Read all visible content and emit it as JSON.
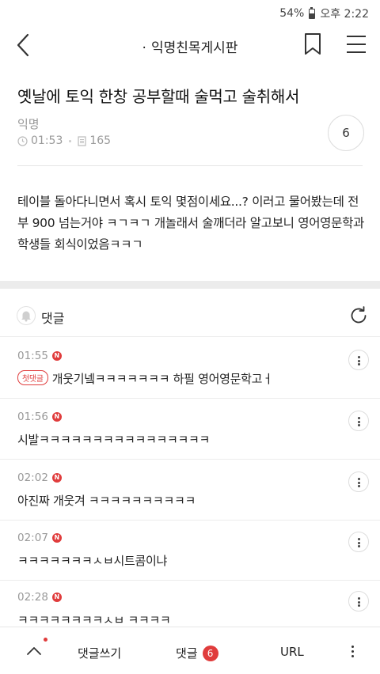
{
  "status_bar": {
    "battery": "54%",
    "time": "오후 2:22"
  },
  "header": {
    "title": "익명친목게시판",
    "title_prefix": "·"
  },
  "post": {
    "title": "옛날에 토익 한창 공부할때 술먹고 술취해서",
    "author": "익명",
    "time": "01:53",
    "views": "165",
    "comment_count": "6",
    "body": "테이블 돌아다니면서 혹시 토익 몇점이세요...? 이러고 물어봤는데 전부 900 넘는거야 ㅋㄱㅋㄱ 개놀래서 술깨더라 알고보니 영어영문학과 학생들 회식이었음ㅋㅋㄱ"
  },
  "comments_section": {
    "label": "댓글",
    "new_badge": "N",
    "first_comment_badge": "첫댓글",
    "items": [
      {
        "time": "01:55",
        "text": "개웃기넼ㅋㅋㅋㅋㅋㅋㅋ 하필 영어영문학고ㅓ"
      },
      {
        "time": "01:56",
        "text": "시발ㅋㅋㅋㅋㅋㅋㅋㅋㅋㅋㅋㅋㅋㅋㅋㅋ"
      },
      {
        "time": "02:02",
        "text": "아진짜 개웃겨 ㅋㅋㅋㅋㅋㅋㅋㅋㅋㅋ"
      },
      {
        "time": "02:07",
        "text": "ㅋㅋㅋㅋㅋㅋㅋㅅㅂ시트콤이냐"
      },
      {
        "time": "02:28",
        "text": "ㅋㅋㅋㅋㅋㅋㅋㅋㅅㅂ ㅋㅋㅋㅋ"
      }
    ]
  },
  "bottom_bar": {
    "write_label": "댓글쓰기",
    "comments_label": "댓글",
    "comments_count": "6",
    "url_label": "URL"
  },
  "colors": {
    "accent": "#e03c3c",
    "separator": "#ececec",
    "muted_text": "#999999"
  },
  "icons": [
    "back-icon",
    "bookmark-icon",
    "hamburger-menu-icon",
    "clock-icon",
    "document-icon",
    "bell-icon",
    "refresh-icon",
    "more-vertical-icon",
    "chevron-up-icon"
  ]
}
